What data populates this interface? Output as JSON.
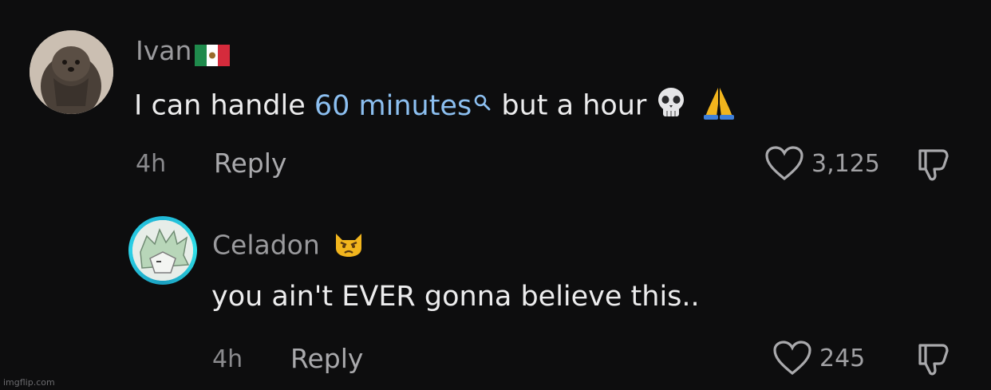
{
  "comments": [
    {
      "username": "Ivan",
      "text_prefix": "I can handle ",
      "link_text": "60 minutes",
      "text_suffix": " but a hour",
      "time": "4h",
      "reply_label": "Reply",
      "likes": "3,125",
      "flag_icon": "mexico-flag-icon",
      "emojis": [
        "skull-emoji",
        "folded-hands-emoji"
      ]
    },
    {
      "username": "Celadon",
      "text": "you ain't EVER gonna believe this..",
      "time": "4h",
      "reply_label": "Reply",
      "likes": "245",
      "emojis": [
        "angry-cat-emoji"
      ]
    }
  ],
  "watermark": "imgflip.com",
  "colors": {
    "background": "#0d0d0e",
    "link": "#8cbff0",
    "ring": "#1fb7d6"
  }
}
